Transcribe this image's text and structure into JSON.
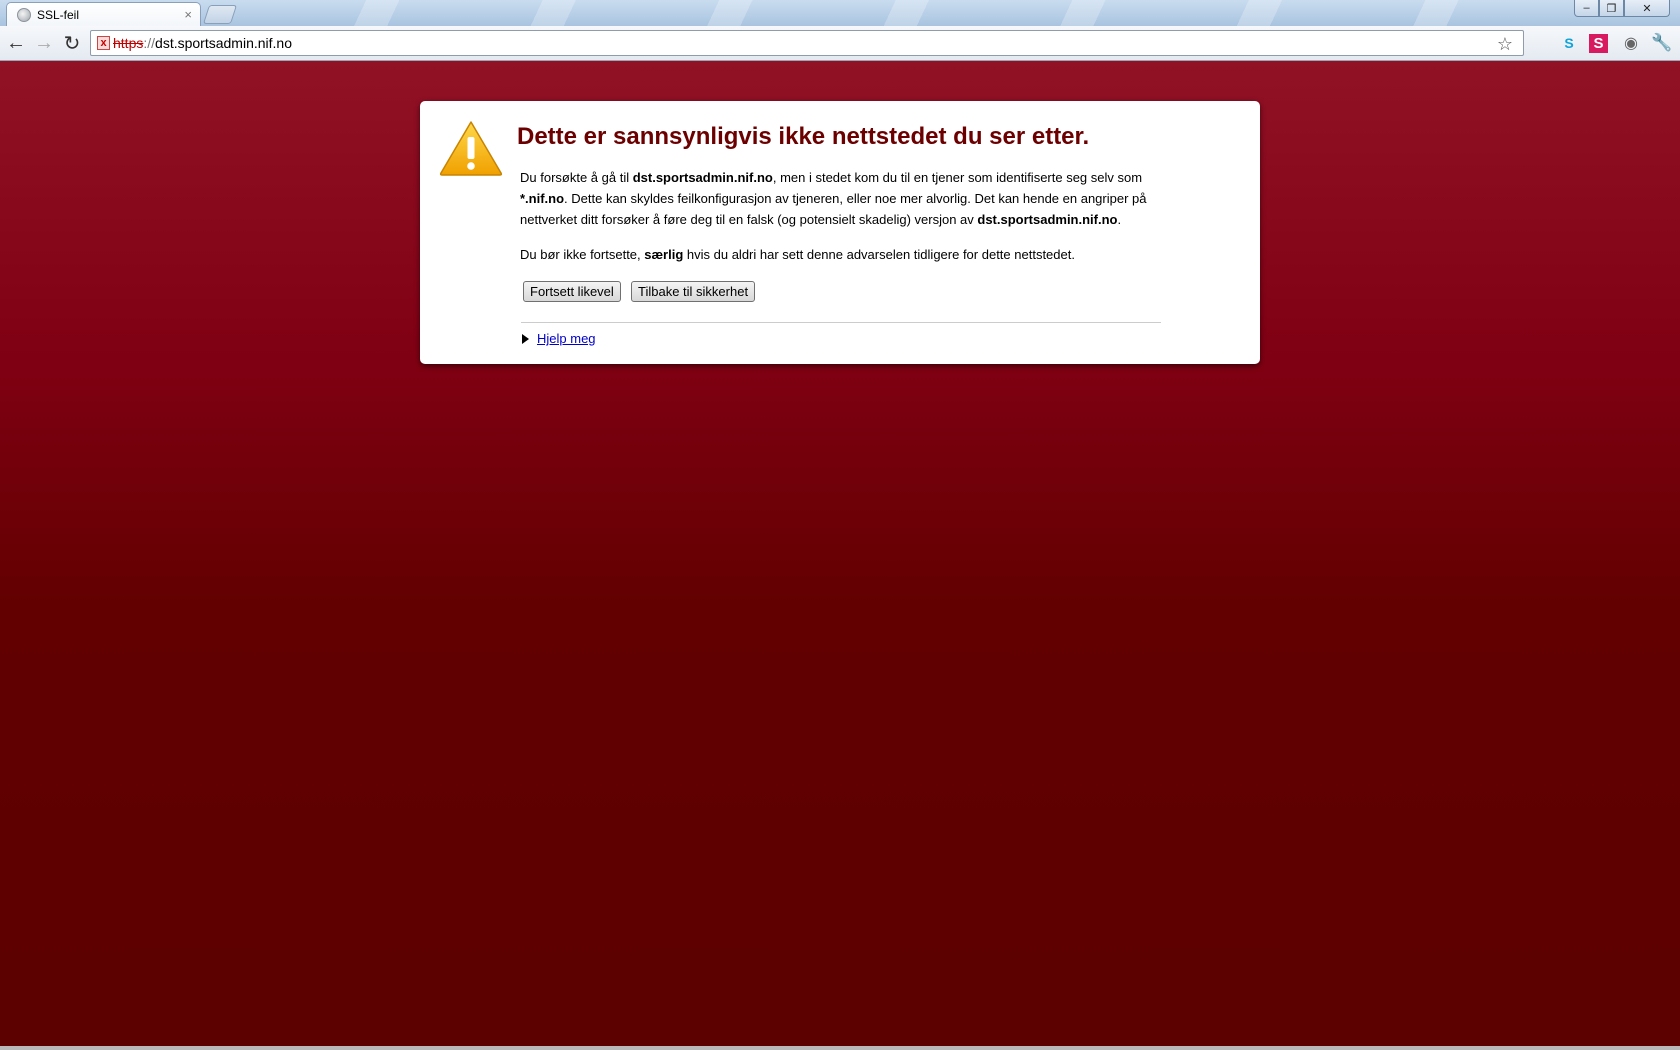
{
  "tab": {
    "title": "SSL-feil",
    "close_glyph": "×",
    "favicon": "globe-icon"
  },
  "window_controls": {
    "minimize": "–",
    "maximize": "❐",
    "close": "✕"
  },
  "toolbar": {
    "back": "←",
    "forward": "→",
    "reload": "↻",
    "url_scheme": "https",
    "url_separator": "://",
    "url_host": "dst.sportsadmin.nif.no",
    "bookmark_star": "☆",
    "extensions": [
      "skype-icon",
      "stumbleupon-icon",
      "eye-icon",
      "wrench-icon"
    ]
  },
  "page": {
    "headline": "Dette er sannsynligvis ikke nettstedet du ser etter.",
    "para1": {
      "t1": "Du forsøkte å gå til ",
      "b1": "dst.sportsadmin.nif.no",
      "t2": ", men i stedet kom du til en tjener som identifiserte seg selv som ",
      "b2": "*.nif.no",
      "t3": ". Dette kan skyldes feilkonfigurasjon av tjeneren, eller noe mer alvorlig. Det kan hende en angriper på nettverket ditt forsøker å føre deg til en falsk (og potensielt skadelig) versjon av ",
      "b3": "dst.sportsadmin.nif.no",
      "t4": "."
    },
    "para2": {
      "t1": "Du bør ikke fortsette, ",
      "b1": "særlig",
      "t2": " hvis du aldri har sett denne advarselen tidligere for dette nettstedet."
    },
    "proceed_button": "Fortsett likevel",
    "back_button": "Tilbake til sikkerhet",
    "help_link": "Hjelp meg"
  },
  "colors": {
    "headline": "#6c0000",
    "background_top": "#911125",
    "background_bottom": "#5c0000",
    "warning_icon": "#f5b400",
    "link": "#0000cc"
  }
}
